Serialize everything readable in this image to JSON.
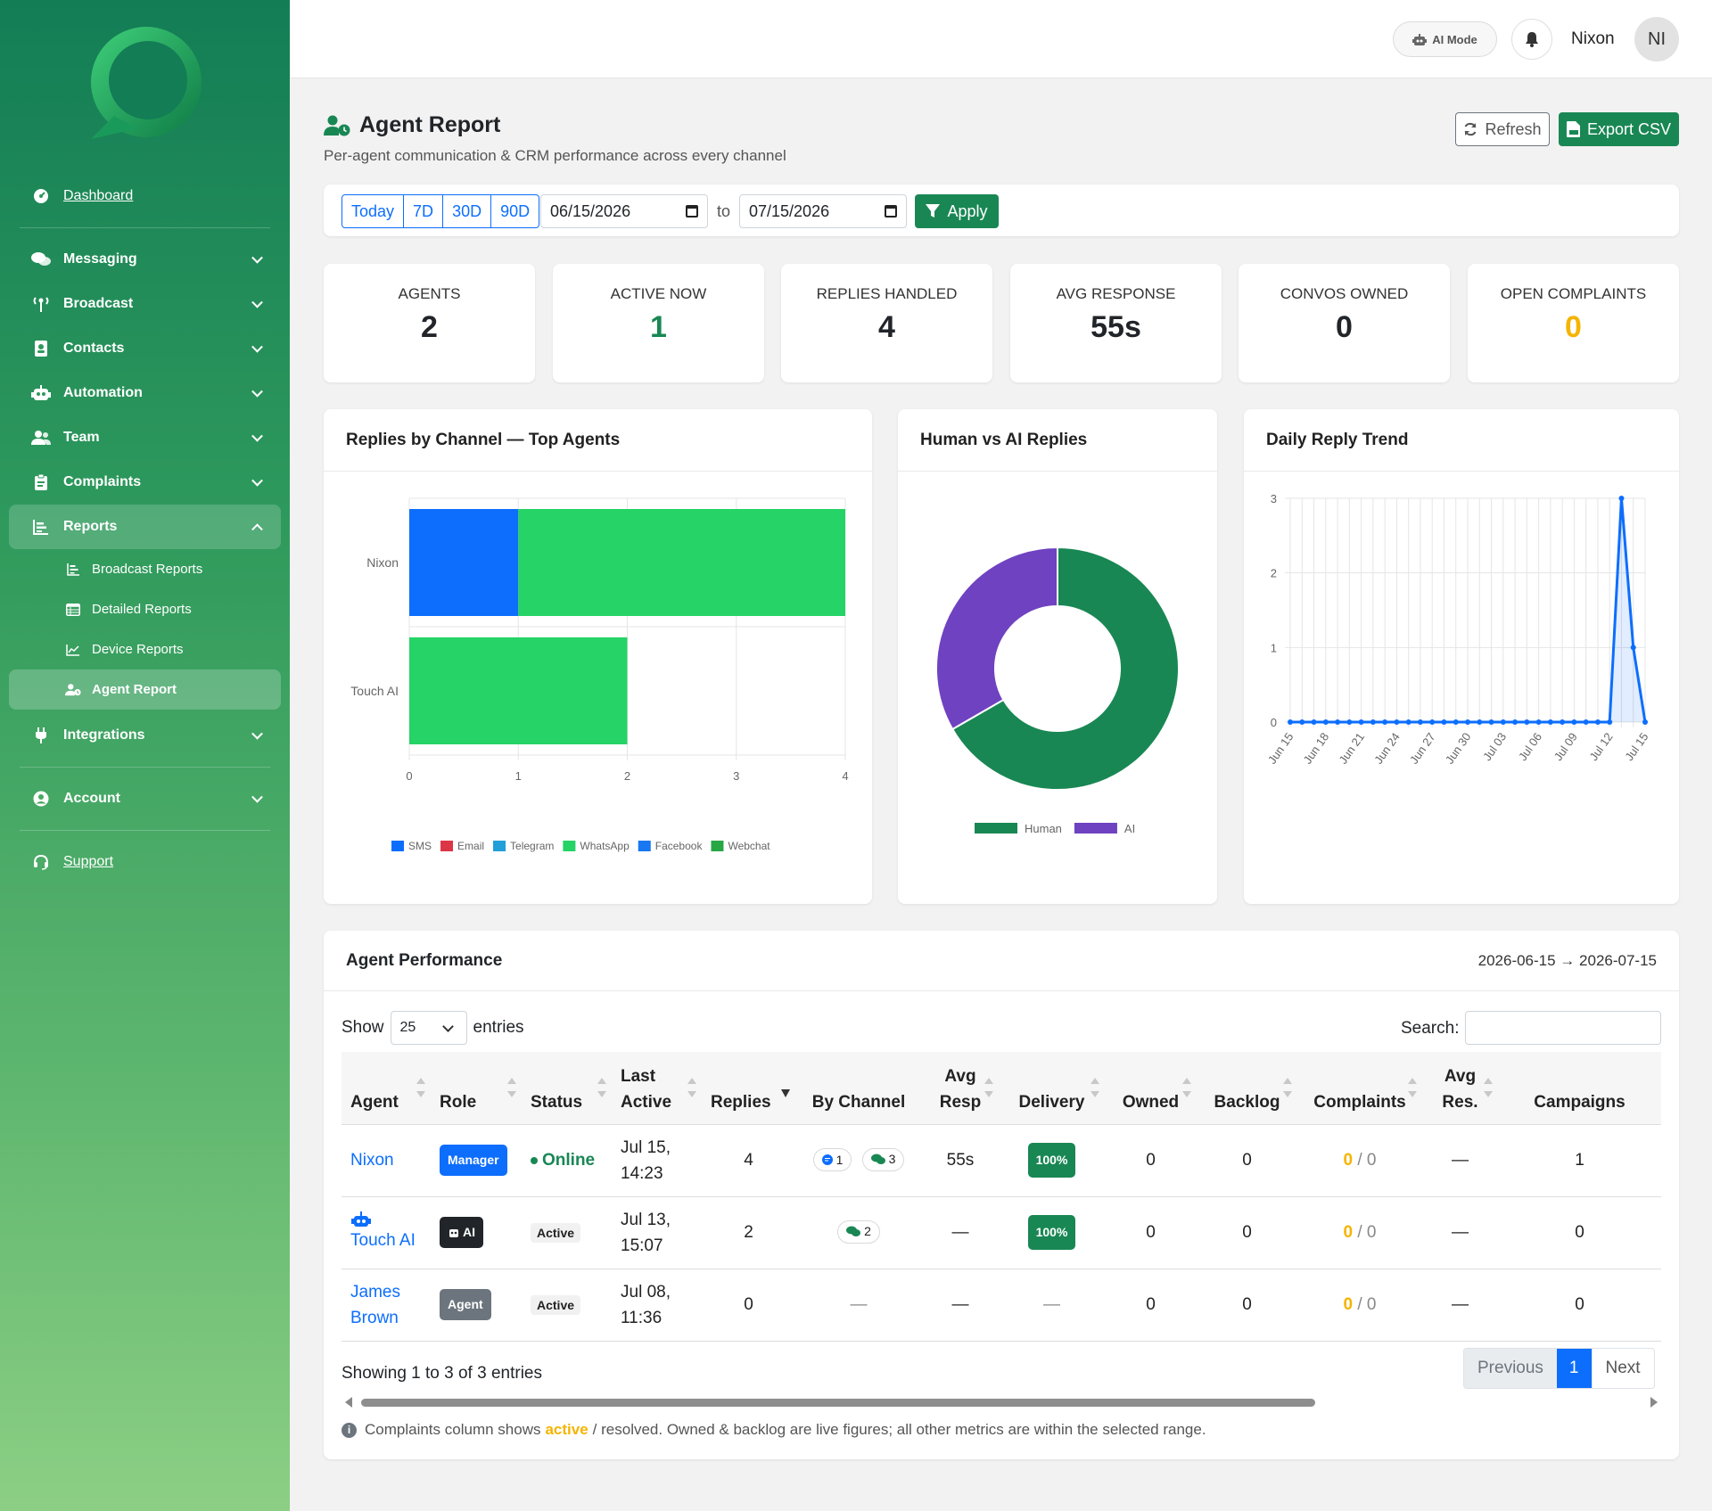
{
  "sidebar": {
    "dashboard": "Dashboard",
    "messaging": "Messaging",
    "broadcast": "Broadcast",
    "contacts": "Contacts",
    "automation": "Automation",
    "team": "Team",
    "complaints": "Complaints",
    "reports": "Reports",
    "sub": {
      "broadcast_reports": "Broadcast Reports",
      "detailed_reports": "Detailed Reports",
      "device_reports": "Device Reports",
      "agent_report": "Agent Report"
    },
    "integrations": "Integrations",
    "account": "Account",
    "support": "Support"
  },
  "topbar": {
    "ai_mode": "AI Mode",
    "user_name": "Nixon",
    "avatar_initials": "NI"
  },
  "header": {
    "title": "Agent Report",
    "subtitle": "Per-agent communication & CRM performance across every channel",
    "refresh": "Refresh",
    "export": "Export CSV"
  },
  "filter": {
    "ranges": [
      "Today",
      "7D",
      "30D",
      "90D"
    ],
    "from": "06/15/2026",
    "to_label": "to",
    "to": "07/15/2026",
    "apply": "Apply"
  },
  "kpis": [
    {
      "label": "AGENTS",
      "value": "2",
      "color": "#212529"
    },
    {
      "label": "ACTIVE NOW",
      "value": "1",
      "color": "#198754"
    },
    {
      "label": "REPLIES HANDLED",
      "value": "4",
      "color": "#212529"
    },
    {
      "label": "AVG RESPONSE",
      "value": "55s",
      "color": "#212529"
    },
    {
      "label": "CONVOS OWNED",
      "value": "0",
      "color": "#212529"
    },
    {
      "label": "OPEN COMPLAINTS",
      "value": "0",
      "color": "#f5b400"
    }
  ],
  "chart_data": [
    {
      "type": "bar",
      "title": "Replies by Channel — Top Agents",
      "orientation": "horizontal",
      "stacked": true,
      "categories": [
        "Nixon",
        "Touch AI"
      ],
      "series": [
        {
          "name": "SMS",
          "color": "#0d6efd",
          "values": [
            1,
            0
          ]
        },
        {
          "name": "Email",
          "color": "#dc3545",
          "values": [
            0,
            0
          ]
        },
        {
          "name": "Telegram",
          "color": "#229ed9",
          "values": [
            0,
            0
          ]
        },
        {
          "name": "WhatsApp",
          "color": "#25d366",
          "values": [
            3,
            2
          ]
        },
        {
          "name": "Facebook",
          "color": "#1877f2",
          "values": [
            0,
            0
          ]
        },
        {
          "name": "Webchat",
          "color": "#28a745",
          "values": [
            0,
            0
          ]
        }
      ],
      "xlim": [
        0,
        4
      ],
      "xticks": [
        "0",
        "1",
        "2",
        "3",
        "4"
      ],
      "grid": true,
      "legend": "bottom"
    },
    {
      "type": "pie",
      "variant": "doughnut",
      "title": "Human vs AI Replies",
      "labels": [
        "Human",
        "AI"
      ],
      "values": [
        2,
        1
      ],
      "colors": [
        "#198754",
        "#6f42c1"
      ],
      "legend": "bottom"
    },
    {
      "type": "area",
      "title": "Daily Reply Trend",
      "x": [
        "Jun 15",
        "Jun 16",
        "Jun 17",
        "Jun 18",
        "Jun 19",
        "Jun 20",
        "Jun 21",
        "Jun 22",
        "Jun 23",
        "Jun 24",
        "Jun 25",
        "Jun 26",
        "Jun 27",
        "Jun 28",
        "Jun 29",
        "Jun 30",
        "Jul 01",
        "Jul 02",
        "Jul 03",
        "Jul 04",
        "Jul 05",
        "Jul 06",
        "Jul 07",
        "Jul 08",
        "Jul 09",
        "Jul 10",
        "Jul 11",
        "Jul 12",
        "Jul 13",
        "Jul 14",
        "Jul 15"
      ],
      "values": [
        0,
        0,
        0,
        0,
        0,
        0,
        0,
        0,
        0,
        0,
        0,
        0,
        0,
        0,
        0,
        0,
        0,
        0,
        0,
        0,
        0,
        0,
        0,
        0,
        0,
        0,
        0,
        0,
        3,
        1,
        0
      ],
      "xticks": [
        "Jun 15",
        "Jun 18",
        "Jun 21",
        "Jun 24",
        "Jun 27",
        "Jun 30",
        "Jul 03",
        "Jul 06",
        "Jul 09",
        "Jul 12",
        "Jul 15"
      ],
      "ylim": [
        0,
        3
      ],
      "yticks": [
        "0",
        "1",
        "2",
        "3"
      ],
      "color": "#0d6efd",
      "grid": true
    }
  ],
  "table": {
    "title": "Agent Performance",
    "range": "2026-06-15 → 2026-07-15",
    "show_label": "Show",
    "entries_value": "25",
    "entries_label": "entries",
    "search_label": "Search:",
    "columns": [
      "Agent",
      "Role",
      "Status",
      "Last Active",
      "Replies",
      "By Channel",
      "Avg Resp",
      "Delivery",
      "Owned",
      "Backlog",
      "Complaints",
      "Avg Res.",
      "Campaigns"
    ],
    "rows": [
      {
        "agent": "Nixon",
        "role": "Manager",
        "status": "Online",
        "last_active": "Jul 15, 14:23",
        "replies": "4",
        "channels": [
          {
            "icon": "sms-icon",
            "count": "1"
          },
          {
            "icon": "whatsapp-icon",
            "count": "3"
          }
        ],
        "avg_resp": "55s",
        "delivery": "100%",
        "owned": "0",
        "backlog": "0",
        "complaints_active": "0",
        "complaints_resolved": "/ 0",
        "avg_res": "—",
        "campaigns": "1"
      },
      {
        "agent": "Touch AI",
        "role": "AI",
        "status": "Active",
        "last_active": "Jul 13, 15:07",
        "replies": "2",
        "channels": [
          {
            "icon": "whatsapp-icon",
            "count": "2"
          }
        ],
        "avg_resp": "—",
        "delivery": "100%",
        "owned": "0",
        "backlog": "0",
        "complaints_active": "0",
        "complaints_resolved": "/ 0",
        "avg_res": "—",
        "campaigns": "0"
      },
      {
        "agent": "James Brown",
        "role": "Agent",
        "status": "Active",
        "last_active": "Jul 08, 11:36",
        "replies": "0",
        "channels_empty": "—",
        "avg_resp": "—",
        "delivery": "—",
        "owned": "0",
        "backlog": "0",
        "complaints_active": "0",
        "complaints_resolved": "/ 0",
        "avg_res": "—",
        "campaigns": "0"
      }
    ],
    "showing": "Showing 1 to 3 of 3 entries",
    "pager": {
      "prev": "Previous",
      "page": "1",
      "next": "Next"
    },
    "note_pre": "Complaints column shows",
    "note_hl": "active",
    "note_post": "/ resolved. Owned & backlog are live figures; all other metrics are within the selected range."
  }
}
